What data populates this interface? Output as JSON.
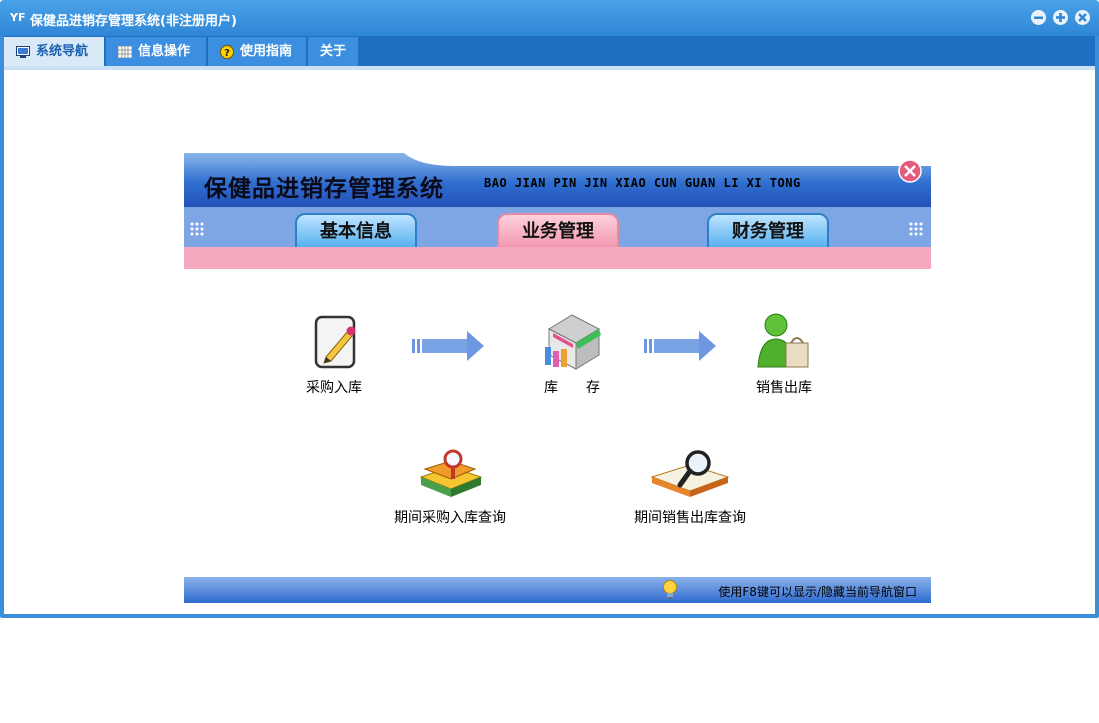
{
  "window": {
    "title": "保健品进销存管理系统(非注册用户)",
    "app_icon": "yf-logo-icon"
  },
  "menu": {
    "tabs": [
      {
        "label": "系统导航",
        "icon": "monitor-icon"
      },
      {
        "label": "信息操作",
        "icon": "grid-icon"
      },
      {
        "label": "使用指南",
        "icon": "help-icon"
      },
      {
        "label": "关于",
        "icon": ""
      }
    ]
  },
  "panel": {
    "title": "保健品进销存管理系统",
    "subtitle": "BAO JIAN PIN JIN XIAO CUN GUAN LI XI TONG",
    "tabs": [
      {
        "label": "基本信息",
        "active": false
      },
      {
        "label": "业务管理",
        "active": true
      },
      {
        "label": "财务管理",
        "active": false
      }
    ],
    "items": [
      {
        "label": "采购入库",
        "icon": "edit-document-icon"
      },
      {
        "label": "库　　存",
        "icon": "warehouse-store-icon"
      },
      {
        "label": "销售出库",
        "icon": "sales-person-icon"
      },
      {
        "label": "期间采购入库查询",
        "icon": "books-search-icon"
      },
      {
        "label": "期间销售出库查询",
        "icon": "book-magnifier-icon"
      }
    ],
    "footer_tip": "使用F8键可以显示/隐藏当前导航窗口"
  },
  "colors": {
    "titlebar": "#3a8fd9",
    "menubar": "#1e6fc2",
    "pink_bar": "#f6a9be",
    "tab_blue": "#57b0ee",
    "tab_pink": "#f29ab1"
  }
}
